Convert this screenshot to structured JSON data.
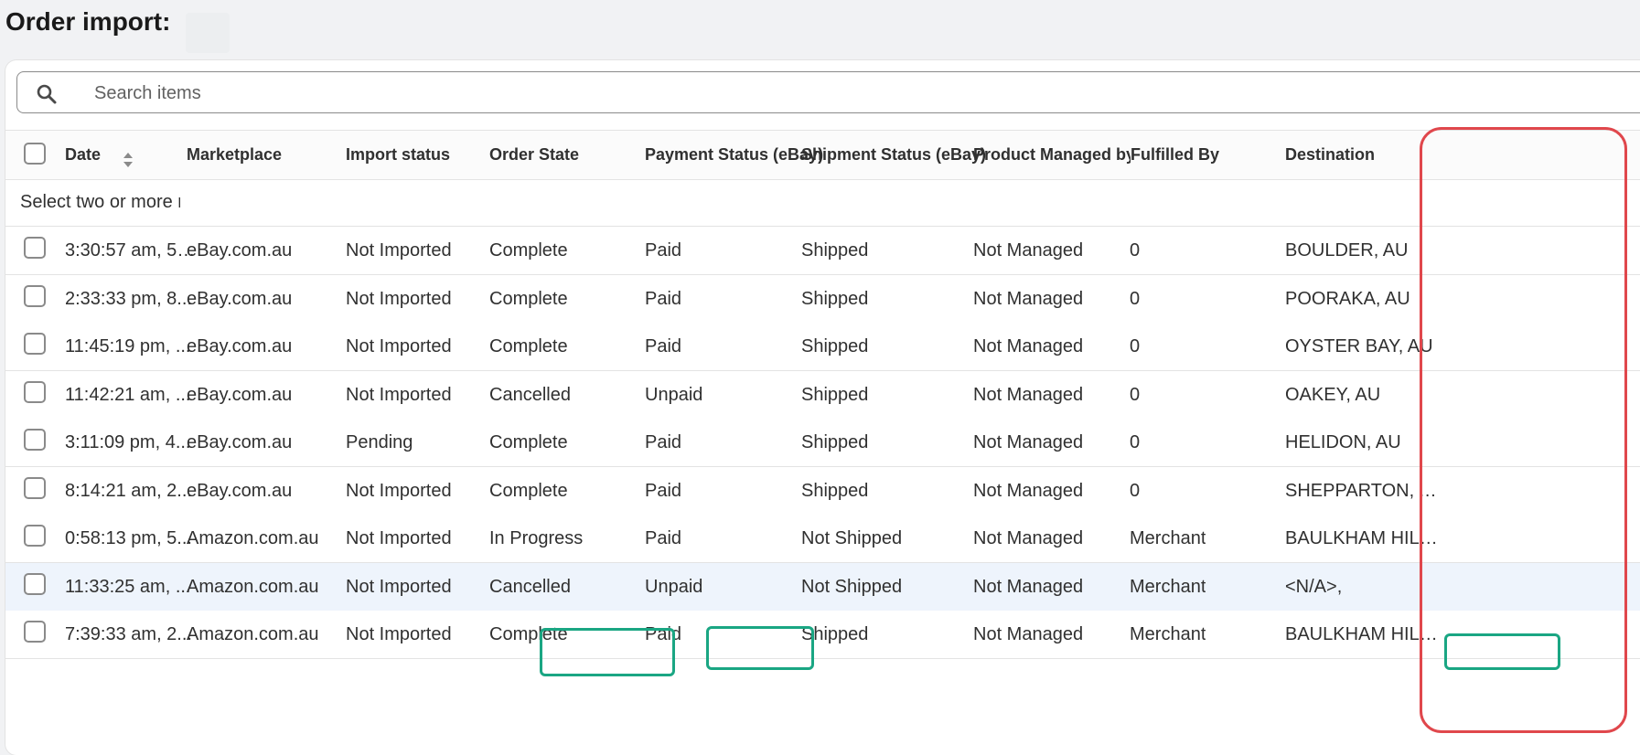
{
  "page": {
    "title": "Order import:"
  },
  "search": {
    "placeholder": "Search items"
  },
  "table": {
    "headers": {
      "date": "Date",
      "marketplace": "Marketplace",
      "import_status": "Import status",
      "order_state": "Order State",
      "payment_status": "Payment Status (eBay)",
      "shipment_status": "Shipment Status (eBay)",
      "product_managed": "Product Managed by Cc",
      "fulfilled_by": "Fulfilled By",
      "destination": "Destination"
    },
    "selection_hint": "Select two or more rc",
    "rows": [
      {
        "date": "3:30:57 am, 5 ...",
        "marketplace": "eBay.com.au",
        "import_status": "Not Imported",
        "order_state": "Complete",
        "payment_status": "Paid",
        "shipment_status": "Shipped",
        "product_managed": "Not Managed",
        "fulfilled_by": "0",
        "destination": "BOULDER, AU"
      },
      {
        "date": "2:33:33 pm, 8...",
        "marketplace": "eBay.com.au",
        "import_status": "Not Imported",
        "order_state": "Complete",
        "payment_status": "Paid",
        "shipment_status": "Shipped",
        "product_managed": "Not Managed",
        "fulfilled_by": "0",
        "destination": "POORAKA, AU"
      },
      {
        "date": "11:45:19 pm, ...",
        "marketplace": "eBay.com.au",
        "import_status": "Not Imported",
        "order_state": "Complete",
        "payment_status": "Paid",
        "shipment_status": "Shipped",
        "product_managed": "Not Managed",
        "fulfilled_by": "0",
        "destination": "OYSTER BAY, AU"
      },
      {
        "date": "11:42:21 am, ...",
        "marketplace": "eBay.com.au",
        "import_status": "Not Imported",
        "order_state": "Cancelled",
        "payment_status": "Unpaid",
        "shipment_status": "Shipped",
        "product_managed": "Not Managed",
        "fulfilled_by": "0",
        "destination": "OAKEY, AU"
      },
      {
        "date": "3:11:09 pm, 4...",
        "marketplace": "eBay.com.au",
        "import_status": "Pending",
        "order_state": "Complete",
        "payment_status": "Paid",
        "shipment_status": "Shipped",
        "product_managed": "Not Managed",
        "fulfilled_by": "0",
        "destination": "HELIDON, AU"
      },
      {
        "date": "8:14:21 am, 2...",
        "marketplace": "eBay.com.au",
        "import_status": "Not Imported",
        "order_state": "Complete",
        "payment_status": "Paid",
        "shipment_status": "Shipped",
        "product_managed": "Not Managed",
        "fulfilled_by": "0",
        "destination": "SHEPPARTON, AU"
      },
      {
        "date": "0:58:13 pm, 5...",
        "marketplace": "Amazon.com.au",
        "import_status": "Not Imported",
        "order_state": "In Progress",
        "payment_status": "Paid",
        "shipment_status": "Not Shipped",
        "product_managed": "Not Managed",
        "fulfilled_by": "Merchant",
        "destination": "BAULKHAM HILLS, ..."
      },
      {
        "date": "11:33:25 am, ...",
        "marketplace": "Amazon.com.au",
        "import_status": "Not Imported",
        "order_state": "Cancelled",
        "payment_status": "Unpaid",
        "shipment_status": "Not Shipped",
        "product_managed": "Not Managed",
        "fulfilled_by": "Merchant",
        "destination": "<N/A>,"
      },
      {
        "date": "7:39:33 am, 2...",
        "marketplace": "Amazon.com.au",
        "import_status": "Not Imported",
        "order_state": "Complete",
        "payment_status": "Paid",
        "shipment_status": "Shipped",
        "product_managed": "Not Managed",
        "fulfilled_by": "Merchant",
        "destination": "BAULKHAM HILLS, ..."
      }
    ]
  },
  "icons": {
    "search": "search-icon",
    "sort": "sort-icon"
  },
  "colors": {
    "annotation_red": "#e0474c",
    "annotation_green": "#1aa683",
    "highlight_row": "#eef4fc"
  }
}
